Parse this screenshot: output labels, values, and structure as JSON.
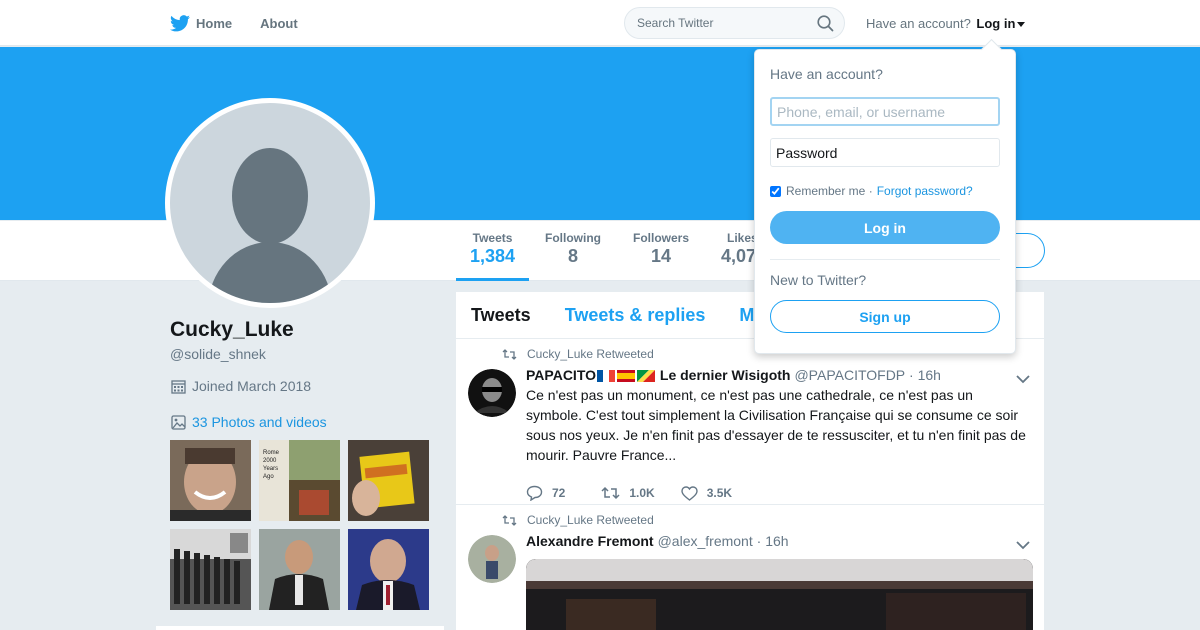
{
  "nav": {
    "home_label": "Home",
    "about_label": "About",
    "search_placeholder": "Search Twitter",
    "account_prompt": "Have an account?",
    "login_label": "Log in"
  },
  "profile": {
    "name": "Cucky_Luke",
    "handle": "@solide_shnek",
    "joined": "Joined March 2018",
    "photos_label": "33 Photos and videos",
    "stats": [
      {
        "label": "Tweets",
        "value": "1,384"
      },
      {
        "label": "Following",
        "value": "8"
      },
      {
        "label": "Followers",
        "value": "14"
      },
      {
        "label": "Likes",
        "value": "4,07"
      }
    ]
  },
  "timeline": {
    "tabs": [
      "Tweets",
      "Tweets & replies",
      "M"
    ],
    "tweets": [
      {
        "retweet_text": "Cucky_Luke Retweeted",
        "author": "PAPACITO",
        "author_suffix": "Le dernier Wisigoth",
        "handle": "@PAPACITOFDP",
        "time": "· 16h",
        "text": "Ce n'est pas un monument, ce n'est pas une cathedrale, ce n'est pas un symbole. C'est tout simplement la Civilisation Française qui se consume ce soir sous nos yeux. Je n'en finit pas d'essayer de te ressusciter, et tu n'en finit pas de mourir. Pauvre France...",
        "replies": "72",
        "retweets": "1.0K",
        "likes": "3.5K"
      },
      {
        "retweet_text": "Cucky_Luke Retweeted",
        "author": "Alexandre Fremont",
        "handle": "@alex_fremont",
        "time": "· 16h"
      }
    ]
  },
  "login_dropdown": {
    "title": "Have an account?",
    "username_placeholder": "Phone, email, or username",
    "password_placeholder": "Password",
    "remember_label": "Remember me ·",
    "forgot_label": "Forgot password?",
    "login_button": "Log in",
    "new_prompt": "New to Twitter?",
    "signup_button": "Sign up"
  },
  "colors": {
    "brand": "#1da1f2",
    "banner": "#1da1f2",
    "background": "#e6ecf0"
  }
}
